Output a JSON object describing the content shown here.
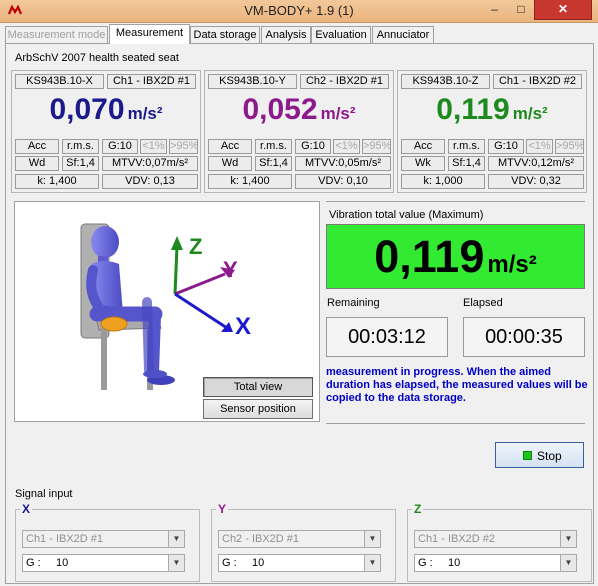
{
  "window": {
    "title": "VM-BODY+ 1.9 (1)",
    "minimize": "–",
    "maximize": "□",
    "close": "✕"
  },
  "tabs": [
    {
      "label": "Measurement mode",
      "state": "disabled"
    },
    {
      "label": "Measurement",
      "state": "active"
    },
    {
      "label": "Data storage",
      "state": "normal"
    },
    {
      "label": "Analysis",
      "state": "normal"
    },
    {
      "label": "Evaluation",
      "state": "normal"
    },
    {
      "label": "Annuciator",
      "state": "normal"
    }
  ],
  "section_title": "ArbSchV 2007 health seated seat",
  "channels": [
    {
      "sensor": "KS943B.10-X",
      "channel": "Ch1 - IBX2D #1",
      "value": "0,070",
      "unit": "m/s²",
      "color": "#1c1a8a",
      "acc": "Acc",
      "rms": "r.m.s.",
      "gain": "G:10",
      "lt": "<1%",
      "gt": ">95%",
      "weighting": "Wd",
      "sf": "Sf:1,4",
      "mtvv": "MTVV:0,07m/s²",
      "k": "k: 1,400",
      "vdv": "VDV: 0,13"
    },
    {
      "sensor": "KS943B.10-Y",
      "channel": "Ch2 - IBX2D #1",
      "value": "0,052",
      "unit": "m/s²",
      "color": "#8c1a8c",
      "acc": "Acc",
      "rms": "r.m.s.",
      "gain": "G:10",
      "lt": "<1%",
      "gt": ">95%",
      "weighting": "Wd",
      "sf": "Sf:1,4",
      "mtvv": "MTVV:0,05m/s²",
      "k": "k: 1,400",
      "vdv": "VDV: 0,10"
    },
    {
      "sensor": "KS943B.10-Z",
      "channel": "Ch1 - IBX2D #2",
      "value": "0,119",
      "unit": "m/s²",
      "color": "#1c8a1c",
      "acc": "Acc",
      "rms": "r.m.s.",
      "gain": "G:10",
      "lt": "<1%",
      "gt": ">95%",
      "weighting": "Wk",
      "sf": "Sf:1,4",
      "mtvv": "MTVV:0,12m/s²",
      "k": "k: 1,000",
      "vdv": "VDV: 0,32"
    }
  ],
  "figure": {
    "axis_x": "X",
    "axis_y": "Y",
    "axis_z": "Z",
    "total_view_label": "Total view",
    "sensor_position_label": "Sensor position"
  },
  "vibration": {
    "label": "Vibration total value (Maximum)",
    "value": "0,119",
    "unit": "m/s²",
    "color": "#33ea33"
  },
  "timers": {
    "remaining_label": "Remaining",
    "remaining": "00:03:12",
    "elapsed_label": "Elapsed",
    "elapsed": "00:00:35"
  },
  "message": "measurement in progress. When the aimed duration has elapsed, the measured values will be copied to the data storage.",
  "stop_label": "Stop",
  "signal_input": {
    "label": "Signal input",
    "groups": [
      {
        "axis": "X",
        "color": "#1c1a8a",
        "channel": "Ch1 - IBX2D #1",
        "gain_label": "G :",
        "gain_value": "10"
      },
      {
        "axis": "Y",
        "color": "#8c1a8c",
        "channel": "Ch2 - IBX2D #1",
        "gain_label": "G :",
        "gain_value": "10"
      },
      {
        "axis": "Z",
        "color": "#1c8a1c",
        "channel": "Ch1 - IBX2D #2",
        "gain_label": "G :",
        "gain_value": "10"
      }
    ]
  }
}
